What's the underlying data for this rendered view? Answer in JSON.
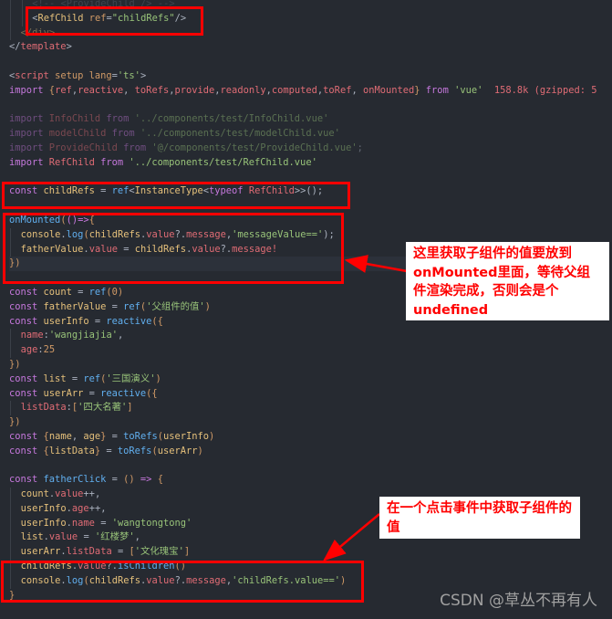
{
  "editor": {
    "lines": [
      {
        "indent": 2,
        "dim": true,
        "tokens": [
          [
            "<!-- <ProvideChild /> -->",
            "c"
          ]
        ]
      },
      {
        "indent": 2,
        "tokens": [
          [
            "<",
            "o"
          ],
          [
            "RefChild",
            "t"
          ],
          [
            " ref",
            "a"
          ],
          [
            "=",
            "o"
          ],
          [
            "\"childRefs\"",
            "s"
          ],
          [
            "/>",
            "o"
          ]
        ]
      },
      {
        "indent": 1,
        "dim": true,
        "tokens": [
          [
            "</div>",
            "t"
          ]
        ]
      },
      {
        "indent": 0,
        "tokens": [
          [
            "</",
            "o"
          ],
          [
            "template",
            "p"
          ],
          [
            ">",
            "o"
          ]
        ]
      },
      {
        "indent": 0,
        "tokens": []
      },
      {
        "indent": 0,
        "tokens": [
          [
            "<",
            "o"
          ],
          [
            "script",
            "p"
          ],
          [
            " setup lang",
            "a"
          ],
          [
            "=",
            "o"
          ],
          [
            "'ts'",
            "s"
          ],
          [
            ">",
            "o"
          ]
        ]
      },
      {
        "indent": 0,
        "tokens": [
          [
            "import ",
            "k"
          ],
          [
            "{",
            "b"
          ],
          [
            "ref",
            "p"
          ],
          [
            ",",
            "o"
          ],
          [
            "reactive",
            "p"
          ],
          [
            ", ",
            "o"
          ],
          [
            "toRefs",
            "p"
          ],
          [
            ",",
            "o"
          ],
          [
            "provide",
            "p"
          ],
          [
            ",",
            "o"
          ],
          [
            "readonly",
            "p"
          ],
          [
            ",",
            "o"
          ],
          [
            "computed",
            "p"
          ],
          [
            ",",
            "o"
          ],
          [
            "toRef",
            "p"
          ],
          [
            ", ",
            "o"
          ],
          [
            "onMounted",
            "p"
          ],
          [
            "} ",
            "b"
          ],
          [
            "from ",
            "k"
          ],
          [
            "'vue'",
            "s"
          ],
          [
            "  158.8k (gzipped: 5",
            "p"
          ]
        ]
      },
      {
        "indent": 0,
        "tokens": []
      },
      {
        "indent": 0,
        "dim": true,
        "tokens": [
          [
            "import ",
            "k"
          ],
          [
            "InfoChild ",
            "p"
          ],
          [
            "from ",
            "k"
          ],
          [
            "'../components/test/InfoChild.vue'",
            "s"
          ]
        ]
      },
      {
        "indent": 0,
        "dim": true,
        "tokens": [
          [
            "import ",
            "k"
          ],
          [
            "modelChild ",
            "p"
          ],
          [
            "from ",
            "k"
          ],
          [
            "'../components/test/modelChild.vue'",
            "s"
          ]
        ]
      },
      {
        "indent": 0,
        "dim": true,
        "tokens": [
          [
            "import ",
            "k"
          ],
          [
            "ProvideChild ",
            "p"
          ],
          [
            "from ",
            "k"
          ],
          [
            "'@/components/test/ProvideChild.vue'",
            "s"
          ],
          [
            ";",
            "o"
          ]
        ]
      },
      {
        "indent": 0,
        "tokens": [
          [
            "import ",
            "k"
          ],
          [
            "RefChild ",
            "p"
          ],
          [
            "from ",
            "k"
          ],
          [
            "'../components/test/RefChild.vue'",
            "s"
          ]
        ]
      },
      {
        "indent": 0,
        "tokens": []
      },
      {
        "indent": 0,
        "tokens": [
          [
            "const ",
            "k"
          ],
          [
            "childRefs ",
            "v"
          ],
          [
            "= ",
            "o"
          ],
          [
            "ref",
            "f"
          ],
          [
            "<",
            "o"
          ],
          [
            "InstanceType",
            "v"
          ],
          [
            "<",
            "o"
          ],
          [
            "typeof ",
            "k"
          ],
          [
            "RefChild",
            "p"
          ],
          [
            ">>",
            "o"
          ],
          [
            "();",
            "o"
          ]
        ]
      },
      {
        "indent": 0,
        "tokens": []
      },
      {
        "indent": 0,
        "tokens": [
          [
            "onMounted",
            "f"
          ],
          [
            "(",
            "b"
          ],
          [
            "()=>",
            "k"
          ],
          [
            "{",
            "b"
          ]
        ]
      },
      {
        "indent": 1,
        "tokens": [
          [
            "console",
            "v"
          ],
          [
            ".",
            "o"
          ],
          [
            "log",
            "f"
          ],
          [
            "(",
            "b"
          ],
          [
            "childRefs",
            "v"
          ],
          [
            ".",
            "o"
          ],
          [
            "value",
            "p"
          ],
          [
            "?.",
            "o"
          ],
          [
            "message",
            "p"
          ],
          [
            ",",
            "o"
          ],
          [
            "'messageValue=='",
            "s"
          ],
          [
            ");",
            "o"
          ]
        ]
      },
      {
        "indent": 1,
        "tokens": [
          [
            "fatherValue",
            "v"
          ],
          [
            ".",
            "o"
          ],
          [
            "value ",
            "p"
          ],
          [
            "= ",
            "o"
          ],
          [
            "childRefs",
            "v"
          ],
          [
            ".",
            "o"
          ],
          [
            "value",
            "p"
          ],
          [
            "?.",
            "o"
          ],
          [
            "message",
            "p"
          ],
          [
            "!",
            "p"
          ]
        ]
      },
      {
        "indent": 0,
        "hl": true,
        "tokens": [
          [
            "})",
            "b"
          ]
        ]
      },
      {
        "indent": 0,
        "tokens": []
      },
      {
        "indent": 0,
        "tokens": [
          [
            "const ",
            "k"
          ],
          [
            "count ",
            "v"
          ],
          [
            "= ",
            "o"
          ],
          [
            "ref",
            "f"
          ],
          [
            "(",
            "b"
          ],
          [
            "0",
            "n"
          ],
          [
            ")",
            "b"
          ]
        ]
      },
      {
        "indent": 0,
        "tokens": [
          [
            "const ",
            "k"
          ],
          [
            "fatherValue ",
            "v"
          ],
          [
            "= ",
            "o"
          ],
          [
            "ref",
            "f"
          ],
          [
            "(",
            "b"
          ],
          [
            "'父组件的值'",
            "s"
          ],
          [
            ")",
            "b"
          ]
        ]
      },
      {
        "indent": 0,
        "tokens": [
          [
            "const ",
            "k"
          ],
          [
            "userInfo ",
            "v"
          ],
          [
            "= ",
            "o"
          ],
          [
            "reactive",
            "f"
          ],
          [
            "({",
            "b"
          ]
        ]
      },
      {
        "indent": 1,
        "tokens": [
          [
            "name",
            "p"
          ],
          [
            ":",
            "o"
          ],
          [
            "'wangjiajia'",
            "s"
          ],
          [
            ",",
            "o"
          ]
        ]
      },
      {
        "indent": 1,
        "tokens": [
          [
            "age",
            "p"
          ],
          [
            ":",
            "o"
          ],
          [
            "25",
            "n"
          ]
        ]
      },
      {
        "indent": 0,
        "tokens": [
          [
            "})",
            "b"
          ]
        ]
      },
      {
        "indent": 0,
        "tokens": [
          [
            "const ",
            "k"
          ],
          [
            "list ",
            "v"
          ],
          [
            "= ",
            "o"
          ],
          [
            "ref",
            "f"
          ],
          [
            "(",
            "b"
          ],
          [
            "'三国演义'",
            "s"
          ],
          [
            ")",
            "b"
          ]
        ]
      },
      {
        "indent": 0,
        "tokens": [
          [
            "const ",
            "k"
          ],
          [
            "userArr ",
            "v"
          ],
          [
            "= ",
            "o"
          ],
          [
            "reactive",
            "f"
          ],
          [
            "({",
            "b"
          ]
        ]
      },
      {
        "indent": 1,
        "tokens": [
          [
            "listData",
            "p"
          ],
          [
            ":",
            "o"
          ],
          [
            "[",
            "b"
          ],
          [
            "'四大名著'",
            "s"
          ],
          [
            "]",
            "b"
          ]
        ]
      },
      {
        "indent": 0,
        "tokens": [
          [
            "})",
            "b"
          ]
        ]
      },
      {
        "indent": 0,
        "tokens": [
          [
            "const ",
            "k"
          ],
          [
            "{",
            "b"
          ],
          [
            "name",
            "v"
          ],
          [
            ", ",
            "o"
          ],
          [
            "age",
            "v"
          ],
          [
            "} ",
            "b"
          ],
          [
            "= ",
            "o"
          ],
          [
            "toRefs",
            "f"
          ],
          [
            "(",
            "b"
          ],
          [
            "userInfo",
            "v"
          ],
          [
            ")",
            "b"
          ]
        ]
      },
      {
        "indent": 0,
        "tokens": [
          [
            "const ",
            "k"
          ],
          [
            "{",
            "b"
          ],
          [
            "listData",
            "v"
          ],
          [
            "} ",
            "b"
          ],
          [
            "= ",
            "o"
          ],
          [
            "toRefs",
            "f"
          ],
          [
            "(",
            "b"
          ],
          [
            "userArr",
            "v"
          ],
          [
            ")",
            "b"
          ]
        ]
      },
      {
        "indent": 0,
        "tokens": []
      },
      {
        "indent": 0,
        "tokens": [
          [
            "const ",
            "k"
          ],
          [
            "fatherClick ",
            "f"
          ],
          [
            "= ",
            "o"
          ],
          [
            "() ",
            "b"
          ],
          [
            "=> ",
            "k"
          ],
          [
            "{",
            "b"
          ]
        ]
      },
      {
        "indent": 1,
        "tokens": [
          [
            "count",
            "v"
          ],
          [
            ".",
            "o"
          ],
          [
            "value",
            "p"
          ],
          [
            "++",
            "o"
          ],
          [
            ",",
            "o"
          ]
        ]
      },
      {
        "indent": 1,
        "tokens": [
          [
            "userInfo",
            "v"
          ],
          [
            ".",
            "o"
          ],
          [
            "age",
            "p"
          ],
          [
            "++",
            "o"
          ],
          [
            ",",
            "o"
          ]
        ]
      },
      {
        "indent": 1,
        "tokens": [
          [
            "userInfo",
            "v"
          ],
          [
            ".",
            "o"
          ],
          [
            "name ",
            "p"
          ],
          [
            "= ",
            "o"
          ],
          [
            "'wangtongtong'",
            "s"
          ]
        ]
      },
      {
        "indent": 1,
        "tokens": [
          [
            "list",
            "v"
          ],
          [
            ".",
            "o"
          ],
          [
            "value ",
            "p"
          ],
          [
            "= ",
            "o"
          ],
          [
            "'红楼梦'",
            "s"
          ],
          [
            ",",
            "o"
          ]
        ]
      },
      {
        "indent": 1,
        "tokens": [
          [
            "userArr",
            "v"
          ],
          [
            ".",
            "o"
          ],
          [
            "listData ",
            "p"
          ],
          [
            "= ",
            "o"
          ],
          [
            "[",
            "b"
          ],
          [
            "'文化瑰宝'",
            "s"
          ],
          [
            "]",
            "b"
          ]
        ]
      },
      {
        "indent": 1,
        "tokens": [
          [
            "childRefs",
            "v"
          ],
          [
            ".",
            "o"
          ],
          [
            "value",
            "p"
          ],
          [
            "?.",
            "o"
          ],
          [
            "isChildren",
            "f"
          ],
          [
            "()",
            "b"
          ]
        ]
      },
      {
        "indent": 1,
        "tokens": [
          [
            "console",
            "v"
          ],
          [
            ".",
            "o"
          ],
          [
            "log",
            "f"
          ],
          [
            "(",
            "b"
          ],
          [
            "childRefs",
            "v"
          ],
          [
            ".",
            "o"
          ],
          [
            "value",
            "p"
          ],
          [
            "?.",
            "o"
          ],
          [
            "message",
            "p"
          ],
          [
            ",",
            "o"
          ],
          [
            "'childRefs.value=='",
            "s"
          ],
          [
            ")",
            "b"
          ]
        ]
      },
      {
        "indent": 0,
        "tokens": [
          [
            "}",
            "b"
          ]
        ]
      }
    ]
  },
  "annotations": {
    "note1": "这里获取子组件的值要放到onMounted里面，等待父组件渲染完成，否则会是个undefined",
    "note2": "在一个点击事件中获取子组件的值",
    "highlight_color": "#ff0000"
  },
  "watermark": "CSDN @草丛不再有人"
}
